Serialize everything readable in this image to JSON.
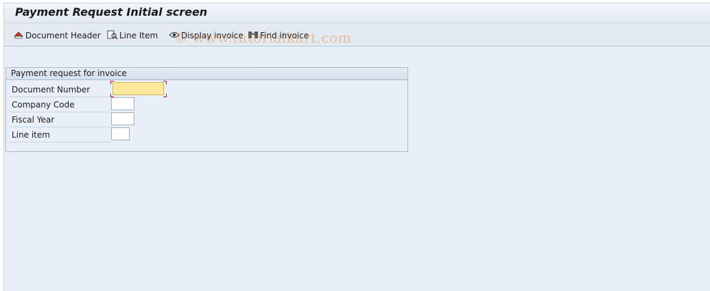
{
  "title": "Payment Request Initial screen",
  "toolbar": {
    "document_header": "Document Header",
    "line_item": "Line Item",
    "display_invoice": "Display invoice",
    "find_invoice": "Find invoice"
  },
  "watermark": "© www.tutorialkart.com",
  "group": {
    "title": "Payment request for invoice",
    "fields": {
      "document_number": {
        "label": "Document Number",
        "value": ""
      },
      "company_code": {
        "label": "Company Code",
        "value": ""
      },
      "fiscal_year": {
        "label": "Fiscal Year",
        "value": ""
      },
      "line_item": {
        "label": "Line item",
        "value": ""
      }
    }
  },
  "colors": {
    "background": "#e9eff6",
    "focused_field": "#fbe89a",
    "focus_corners": "#d01010"
  },
  "icons": [
    "document-header-icon",
    "line-item-icon",
    "display-invoice-icon",
    "find-invoice-icon"
  ]
}
